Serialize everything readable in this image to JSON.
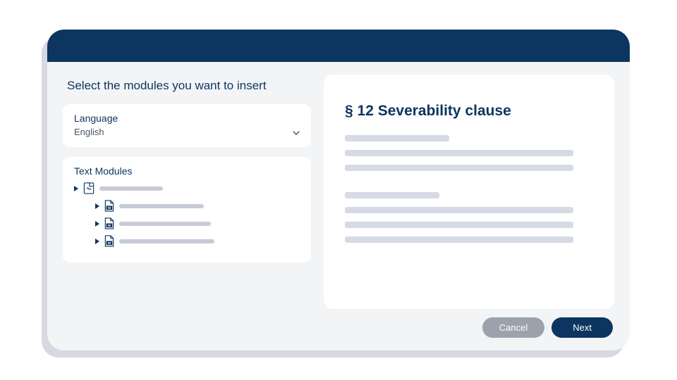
{
  "title": "Select the modules you want to insert",
  "language": {
    "label": "Language",
    "value": "English"
  },
  "text_modules": {
    "label": "Text Modules"
  },
  "preview": {
    "title": "§ 12 Severability clause"
  },
  "buttons": {
    "cancel": "Cancel",
    "next": "Next"
  }
}
